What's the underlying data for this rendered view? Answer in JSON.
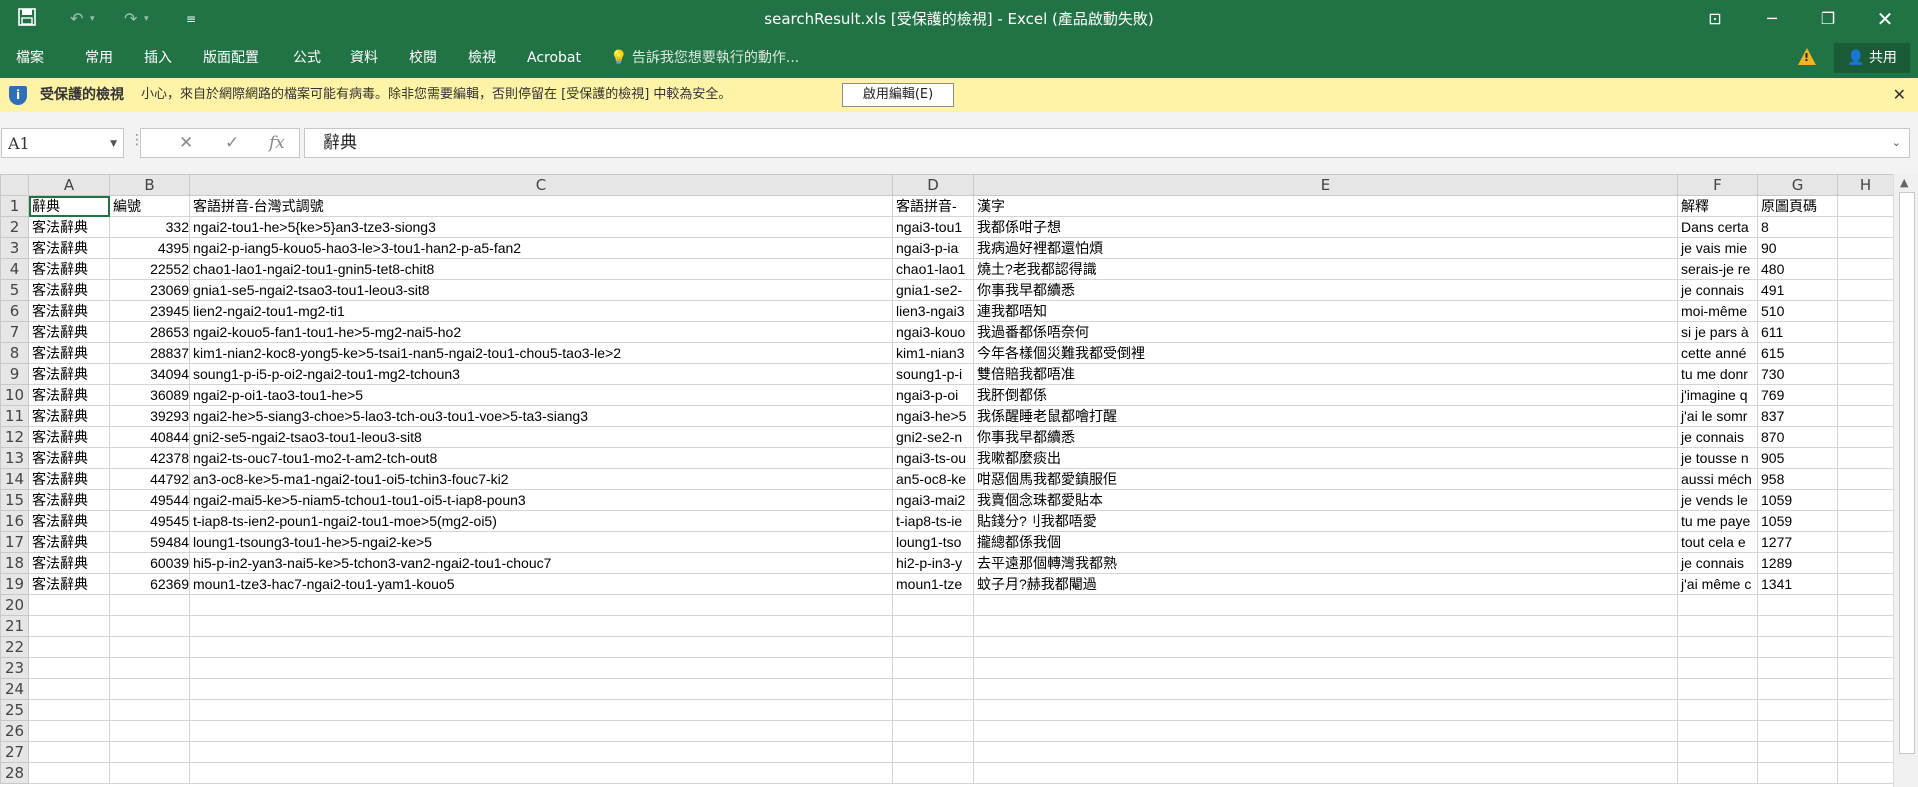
{
  "window": {
    "title": "searchResult.xls  [受保護的檢視] - Excel (產品啟動失敗)",
    "qat": {
      "save_icon": "save-icon",
      "undo_icon": "undo-icon",
      "redo_icon": "redo-icon",
      "customize_icon": "customize-qat-icon"
    },
    "controls": {
      "ribbon_display": "ribbon-display-icon",
      "minimize": "minimize-icon",
      "restore": "restore-icon",
      "close": "close-icon"
    }
  },
  "ribbon": {
    "tabs": [
      "檔案",
      "常用",
      "插入",
      "版面配置",
      "公式",
      "資料",
      "校閱",
      "檢視",
      "Acrobat"
    ],
    "tell_me": "告訴我您想要執行的動作...",
    "share": "共用"
  },
  "message_bar": {
    "title": "受保護的檢視",
    "text": "小心，來自於網際網路的檔案可能有病毒。除非您需要編輯，否則停留在 [受保護的檢視] 中較為安全。",
    "button": "啟用編輯(E)"
  },
  "formula_bar": {
    "name_box": "A1",
    "formula": "辭典"
  },
  "sheet": {
    "columns": [
      "A",
      "B",
      "C",
      "D",
      "E",
      "F",
      "G",
      "H"
    ],
    "rows": [
      [
        "辭典",
        "編號",
        "客語拼音-台灣式調號",
        "客語拼音-",
        "漢字",
        "解釋",
        "原圖頁碼",
        ""
      ],
      [
        "客法辭典",
        "332",
        "ngai2-tou1-he>5{ke>5}an3-tze3-siong3",
        "ngai3-tou1",
        "我都係咁子想",
        "Dans certa",
        "8",
        ""
      ],
      [
        "客法辭典",
        "4395",
        "ngai2-p-iang5-kouo5-hao3-le>3-tou1-han2-p-a5-fan2",
        "ngai3-p-ia",
        "我病過好裡都還怕煩",
        "je vais mie",
        "90",
        ""
      ],
      [
        "客法辭典",
        "22552",
        "chao1-lao1-ngai2-tou1-gnin5-tet8-chit8",
        "chao1-lao1",
        "燒土?老我都認得識",
        "serais-je re",
        "480",
        ""
      ],
      [
        "客法辭典",
        "23069",
        "gnia1-se5-ngai2-tsao3-tou1-leou3-sit8",
        "gnia1-se2-",
        "你事我早都續悉",
        "je connais",
        "491",
        ""
      ],
      [
        "客法辭典",
        "23945",
        "lien2-ngai2-tou1-mg2-ti1",
        "lien3-ngai3",
        "連我都唔知",
        "moi-même",
        "510",
        ""
      ],
      [
        "客法辭典",
        "28653",
        "ngai2-kouo5-fan1-tou1-he>5-mg2-nai5-ho2",
        "ngai3-kouo",
        "我過番都係唔奈何",
        "si je pars à",
        "611",
        ""
      ],
      [
        "客法辭典",
        "28837",
        "kim1-nian2-koc8-yong5-ke>5-tsai1-nan5-ngai2-tou1-chou5-tao3-le>2",
        "kim1-nian3",
        "今年各樣個災難我都受倒裡",
        "cette anné",
        "615",
        ""
      ],
      [
        "客法辭典",
        "34094",
        "soung1-p-i5-p-oi2-ngai2-tou1-mg2-tchoun3",
        "soung1-p-i",
        "雙倍賠我都唔准",
        "tu me donr",
        "730",
        ""
      ],
      [
        "客法辭典",
        "36089",
        "ngai2-p-oi1-tao3-tou1-he>5",
        "ngai3-p-oi",
        "我肧倒都係",
        "j'imagine q",
        "769",
        ""
      ],
      [
        "客法辭典",
        "39293",
        "ngai2-he>5-siang3-choe>5-lao3-tch-ou3-tou1-voe>5-ta3-siang3",
        "ngai3-he>5",
        "我係醒睡老鼠都噲打醒",
        "j'ai le somr",
        "837",
        ""
      ],
      [
        "客法辭典",
        "40844",
        "gni2-se5-ngai2-tsao3-tou1-leou3-sit8",
        "gni2-se2-n",
        "你事我早都續悉",
        "je connais",
        "870",
        ""
      ],
      [
        "客法辭典",
        "42378",
        "ngai2-ts-ouc7-tou1-mo2-t-am2-tch-out8",
        "ngai3-ts-ou",
        "我嗽都麼痰出",
        "je tousse n",
        "905",
        ""
      ],
      [
        "客法辭典",
        "44792",
        "an3-oc8-ke>5-ma1-ngai2-tou1-oi5-tchin3-fouc7-ki2",
        "an5-oc8-ke",
        "咁惡個馬我都愛鎮服佢",
        "aussi méch",
        "958",
        ""
      ],
      [
        "客法辭典",
        "49544",
        "ngai2-mai5-ke>5-niam5-tchou1-tou1-oi5-t-iap8-poun3",
        "ngai3-mai2",
        "我賣個念珠都愛貼本",
        "je vends le",
        "1059",
        ""
      ],
      [
        "客法辭典",
        "49545",
        "t-iap8-ts-ien2-poun1-ngai2-tou1-moe>5(mg2-oi5)",
        "t-iap8-ts-ie",
        "貼錢分?刂我都唔愛",
        "tu me paye",
        "1059",
        ""
      ],
      [
        "客法辭典",
        "59484",
        "loung1-tsoung3-tou1-he>5-ngai2-ke>5",
        "loung1-tso",
        "攏總都係我個",
        "tout cela e",
        "1277",
        ""
      ],
      [
        "客法辭典",
        "60039",
        "hi5-p-in2-yan3-nai5-ke>5-tchon3-van2-ngai2-tou1-chouc7",
        "hi2-p-in3-y",
        "去平遠那個轉灣我都熟",
        "je connais",
        "1289",
        ""
      ],
      [
        "客法辭典",
        "62369",
        "moun1-tze3-hac7-ngai2-tou1-yam1-kouo5",
        "moun1-tze",
        "蚊子月?赫我都閹過",
        "j'ai même c",
        "1341",
        ""
      ],
      [
        "",
        "",
        "",
        "",
        "",
        "",
        "",
        ""
      ],
      [
        "",
        "",
        "",
        "",
        "",
        "",
        "",
        ""
      ],
      [
        "",
        "",
        "",
        "",
        "",
        "",
        "",
        ""
      ],
      [
        "",
        "",
        "",
        "",
        "",
        "",
        "",
        ""
      ],
      [
        "",
        "",
        "",
        "",
        "",
        "",
        "",
        ""
      ],
      [
        "",
        "",
        "",
        "",
        "",
        "",
        "",
        ""
      ],
      [
        "",
        "",
        "",
        "",
        "",
        "",
        "",
        ""
      ],
      [
        "",
        "",
        "",
        "",
        "",
        "",
        "",
        ""
      ],
      [
        "",
        "",
        "",
        "",
        "",
        "",
        "",
        ""
      ]
    ]
  }
}
